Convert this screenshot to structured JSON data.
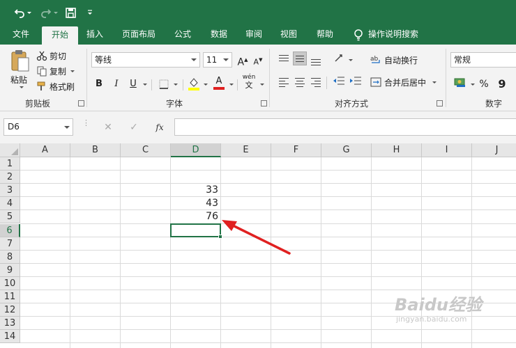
{
  "quick_access": {
    "undo_icon": "undo-icon",
    "redo_icon": "redo-icon",
    "save_icon": "save-icon",
    "customize_icon": "customize-qat-icon"
  },
  "tabs": [
    {
      "label": "文件",
      "active": false
    },
    {
      "label": "开始",
      "active": true
    },
    {
      "label": "插入",
      "active": false
    },
    {
      "label": "页面布局",
      "active": false
    },
    {
      "label": "公式",
      "active": false
    },
    {
      "label": "数据",
      "active": false
    },
    {
      "label": "审阅",
      "active": false
    },
    {
      "label": "视图",
      "active": false
    },
    {
      "label": "帮助",
      "active": false
    }
  ],
  "tell_me": "操作说明搜索",
  "ribbon": {
    "clipboard": {
      "paste": "粘贴",
      "cut": "剪切",
      "copy": "复制",
      "format_painter": "格式刷",
      "label": "剪贴板"
    },
    "font": {
      "font_name": "等线",
      "font_size": "11",
      "grow": "A",
      "shrink": "A",
      "bold": "B",
      "italic": "I",
      "underline": "U",
      "font_color": "A",
      "phonetic": "wén",
      "phonetic_sub": "文",
      "label": "字体"
    },
    "alignment": {
      "wrap_text": "自动换行",
      "merge_center": "合并后居中",
      "label": "对齐方式"
    },
    "number": {
      "format": "常规",
      "percent": "%",
      "comma": "9",
      "label": "数字"
    }
  },
  "formula_bar": {
    "name_box": "D6",
    "fx": "fx",
    "value": ""
  },
  "columns": [
    "A",
    "B",
    "C",
    "D",
    "E",
    "F",
    "G",
    "H",
    "I",
    "J"
  ],
  "rows": [
    "1",
    "2",
    "3",
    "4",
    "5",
    "6",
    "7",
    "8",
    "9",
    "10",
    "11",
    "12",
    "13",
    "14"
  ],
  "cells": {
    "D3": "33",
    "D4": "43",
    "D5": "76"
  },
  "selected_cell": "D6",
  "annotation": {
    "type": "arrow",
    "color": "#e02020"
  },
  "watermark": {
    "text": "Baidu经验",
    "url": "jingyan.baidu.com"
  },
  "colors": {
    "accent": "#217346",
    "ribbon_bg": "#f3f3f3"
  }
}
